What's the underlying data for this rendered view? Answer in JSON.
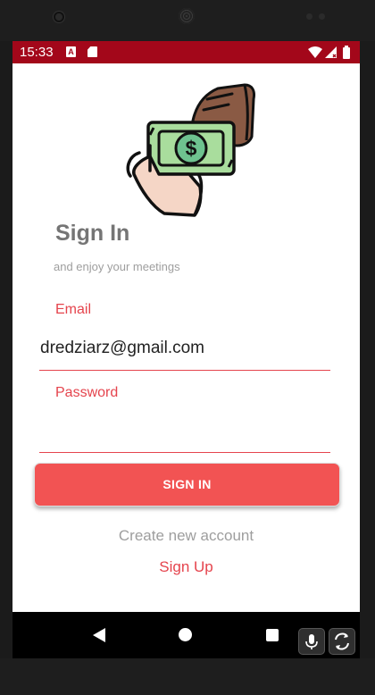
{
  "status_bar": {
    "time": "15:33",
    "icons": [
      "a-notification-icon",
      "sd-card-icon",
      "wifi-icon",
      "signal-icon",
      "battery-icon"
    ]
  },
  "login": {
    "title": "Sign In",
    "subtitle": "and enjoy your meetings",
    "email_label": "Email",
    "email_value": "dredziarz@gmail.com",
    "password_label": "Password",
    "password_value": "",
    "sign_in_button": "SIGN IN",
    "create_account": "Create new account",
    "sign_up_link": "Sign Up"
  },
  "nav_bar": {
    "buttons": [
      "back-icon",
      "home-icon",
      "recents-icon"
    ]
  },
  "emulator_controls": [
    "microphone-icon",
    "rotate-icon"
  ],
  "colors": {
    "status_bar": "#a3071a",
    "accent": "#e5444d",
    "button": "#f25353",
    "muted_text": "#9e9e9e"
  }
}
